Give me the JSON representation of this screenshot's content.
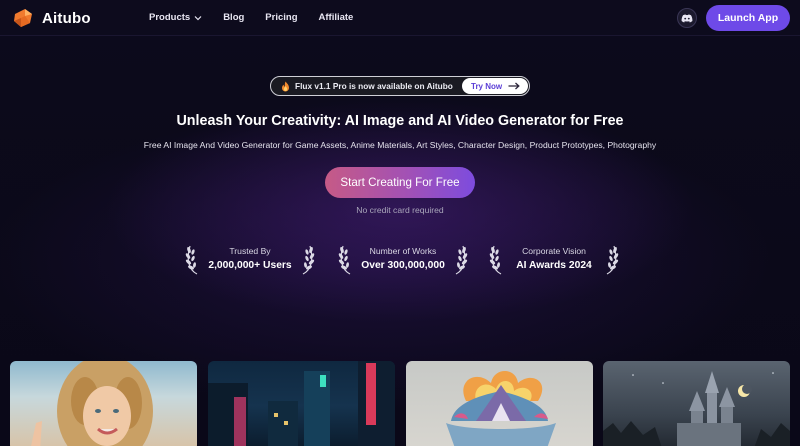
{
  "header": {
    "brand": "Aitubo",
    "nav": [
      {
        "label": "Products",
        "has_dropdown": true
      },
      {
        "label": "Blog"
      },
      {
        "label": "Pricing"
      },
      {
        "label": "Affiliate"
      }
    ],
    "discord_icon": "discord-icon",
    "launch_label": "Launch App"
  },
  "announcement": {
    "text": "Flux v1.1 Pro is now available on Aitubo",
    "cta": "Try Now"
  },
  "hero": {
    "headline": "Unleash Your Creativity: AI Image and AI Video Generator for Free",
    "subheadline": "Free AI Image And Video Generator for Game Assets, Anime Materials, Art Styles, Character Design, Product Prototypes, Photography",
    "cta": "Start Creating For Free",
    "note": "No credit card required"
  },
  "stats": [
    {
      "label": "Trusted By",
      "value": "2,000,000+ Users"
    },
    {
      "label": "Number of Works",
      "value": "Over 300,000,000"
    },
    {
      "label": "Corporate Vision",
      "value": "AI Awards 2024"
    }
  ],
  "gallery": [
    {
      "name": "portrait-woman"
    },
    {
      "name": "neon-city-street"
    },
    {
      "name": "fantasy-floating-island"
    },
    {
      "name": "castle-moon-night"
    }
  ],
  "colors": {
    "accent": "#6e4ae8",
    "cta_start": "#c65a86",
    "cta_end": "#7d4cde",
    "background": "#0a0818"
  }
}
